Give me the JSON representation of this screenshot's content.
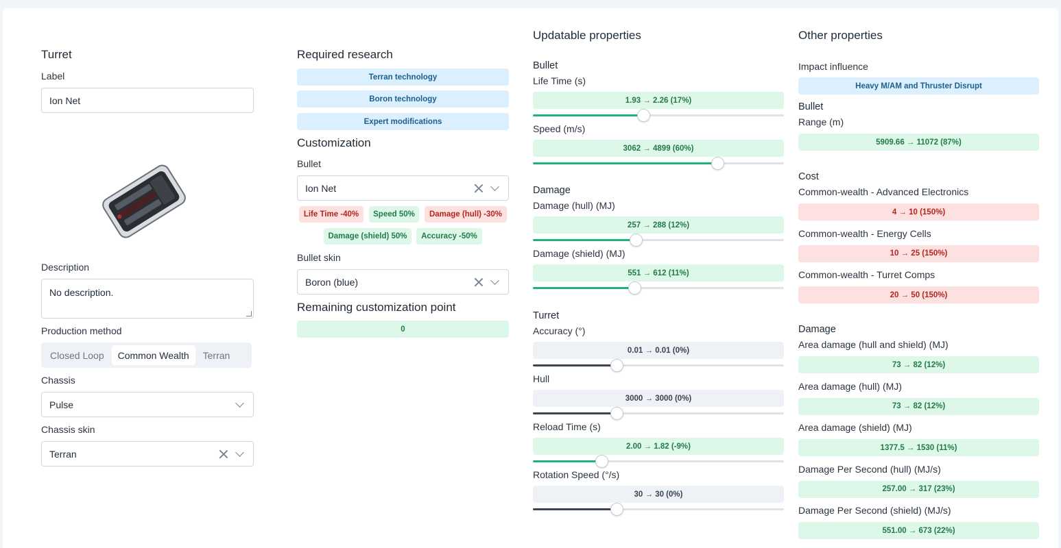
{
  "left": {
    "title": "Turret",
    "label_label": "Label",
    "label_value": "Ion Net",
    "description_label": "Description",
    "description_value": "No description.",
    "production_label": "Production method",
    "production_options": [
      "Closed Loop",
      "Common Wealth",
      "Terran"
    ],
    "production_selected": "Common Wealth",
    "chassis_label": "Chassis",
    "chassis_value": "Pulse",
    "chassis_skin_label": "Chassis skin",
    "chassis_skin_value": "Terran"
  },
  "research": {
    "title": "Required research",
    "items": [
      "Terran technology",
      "Boron technology",
      "Expert modifications"
    ]
  },
  "customization": {
    "title": "Customization",
    "bullet_label": "Bullet",
    "bullet_value": "Ion Net",
    "tags": [
      {
        "text": "Life Time -40%",
        "kind": "red"
      },
      {
        "text": "Speed 50%",
        "kind": "green"
      },
      {
        "text": "Damage (hull) -30%",
        "kind": "red"
      },
      {
        "text": "Damage (shield) 50%",
        "kind": "green"
      },
      {
        "text": "Accuracy -50%",
        "kind": "green"
      }
    ],
    "bullet_skin_label": "Bullet skin",
    "bullet_skin_value": "Boron (blue)",
    "remaining_title": "Remaining customization point",
    "remaining_value": "0"
  },
  "updatable": {
    "title": "Updatable properties",
    "groups": [
      {
        "name": "Bullet",
        "props": [
          {
            "label": "Life Time (s)",
            "value": "1.93 → 2.26 (17%)",
            "kind": "green",
            "level": 0.44
          },
          {
            "label": "Speed (m/s)",
            "value": "3062 → 4899 (60%)",
            "kind": "green",
            "level": 0.735
          }
        ]
      },
      {
        "name": "Damage",
        "props": [
          {
            "label": "Damage (hull) (MJ)",
            "value": "257 → 288 (12%)",
            "kind": "green",
            "level": 0.41
          },
          {
            "label": "Damage (shield) (MJ)",
            "value": "551 → 612 (11%)",
            "kind": "green",
            "level": 0.405
          }
        ]
      },
      {
        "name": "Turret",
        "props": [
          {
            "label": "Accuracy (°)",
            "value": "0.01 → 0.01 (0%)",
            "kind": "gray",
            "level": 0.333
          },
          {
            "label": "Hull",
            "value": "3000 → 3000 (0%)",
            "kind": "gray",
            "level": 0.333
          },
          {
            "label": "Reload Time (s)",
            "value": "2.00 → 1.82 (-9%)",
            "kind": "green",
            "level": 0.272
          },
          {
            "label": "Rotation Speed (°/s)",
            "value": "30 → 30 (0%)",
            "kind": "gray",
            "level": 0.333
          }
        ]
      }
    ]
  },
  "other": {
    "title": "Other properties",
    "impact_label": "Impact influence",
    "impact_value": "Heavy M/AM and Thruster Disrupt",
    "bullet_group": "Bullet",
    "range_label": "Range (m)",
    "range_value": "5909.66 → 11072 (87%)",
    "cost_group": "Cost",
    "cost": [
      {
        "label": "Common-wealth - Advanced Electronics",
        "value": "4 → 10 (150%)"
      },
      {
        "label": "Common-wealth - Energy Cells",
        "value": "10 → 25 (150%)"
      },
      {
        "label": "Common-wealth - Turret Comps",
        "value": "20 → 50 (150%)"
      }
    ],
    "damage_group": "Damage",
    "damage": [
      {
        "label": "Area damage (hull and shield) (MJ)",
        "value": "73 → 82 (12%)"
      },
      {
        "label": "Area damage (hull) (MJ)",
        "value": "73 → 82 (12%)"
      },
      {
        "label": "Area damage (shield) (MJ)",
        "value": "1377.5 → 1530 (11%)"
      },
      {
        "label": "Damage Per Second (hull) (MJ/s)",
        "value": "257.00 → 317 (23%)"
      },
      {
        "label": "Damage Per Second (shield) (MJ/s)",
        "value": "551.00 → 673 (22%)"
      }
    ]
  },
  "colors": {
    "green_bg": "#ddf8e8",
    "red_bg": "#fde0e0",
    "blue_bg": "#dcefff",
    "slider_green": "#20b27b"
  }
}
